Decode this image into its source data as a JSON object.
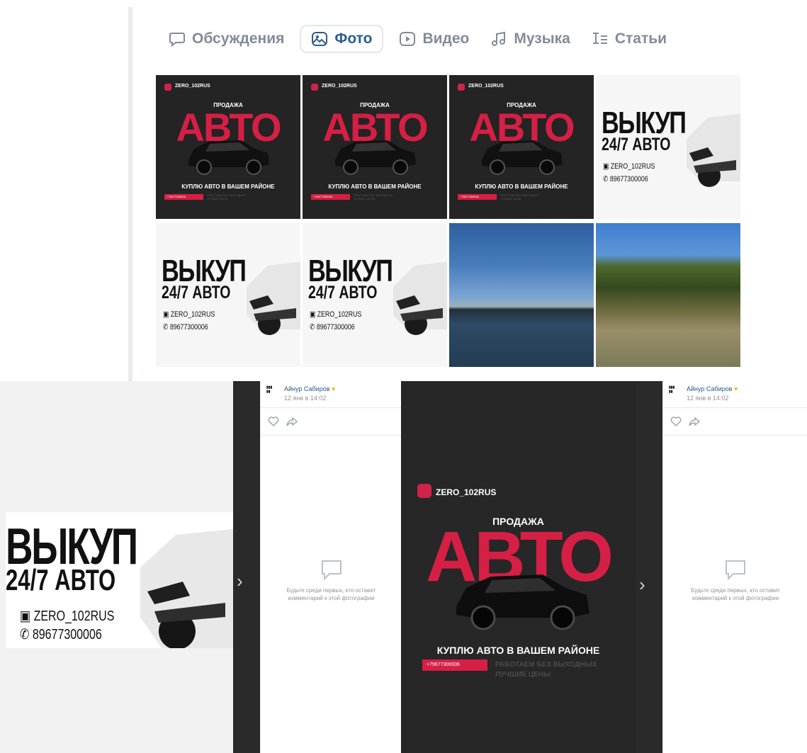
{
  "tabs": [
    {
      "label": "Обсуждения",
      "icon": "chat-bubble-icon",
      "active": false
    },
    {
      "label": "Фото",
      "icon": "photo-icon",
      "active": true
    },
    {
      "label": "Видео",
      "icon": "play-icon",
      "active": false
    },
    {
      "label": "Музыка",
      "icon": "music-note-icon",
      "active": false
    },
    {
      "label": "Статьи",
      "icon": "article-icon",
      "active": false
    }
  ],
  "tile_dark": {
    "handle": "ZERO_102RUS",
    "sale": "ПРОДАЖА",
    "big": "АВТО",
    "buy": "КУПЛЮ АВТО В ВАШЕМ РАЙОНЕ",
    "phone": "+79677300006",
    "work1": "РАБОТАЕМ БЕЗ ВЫХОДНЫХ",
    "work2": "ЛУЧШИЕ ЦЕНЫ"
  },
  "tile_white": {
    "line1": "ВЫКУП",
    "line2": "24/7 АВТО",
    "insta": "ZERO_102RUS",
    "phone": "89677300006"
  },
  "post": {
    "author": "Айнур Сабиров",
    "date": "12 янв в 14:02",
    "empty_line1": "Будьте среди первых, кто оставит",
    "empty_line2": "комментарий к этой фотографии"
  },
  "colors": {
    "accent": "#d61f45",
    "link": "#2a5885",
    "dark_bg": "#242424",
    "tab_active": "#2c5d8f",
    "tab_inactive": "#818c99"
  }
}
